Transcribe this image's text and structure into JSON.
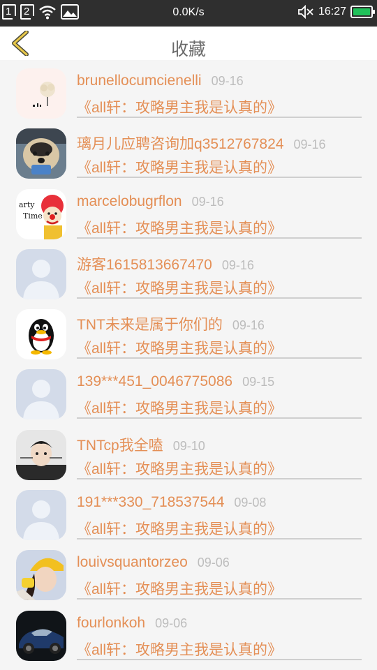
{
  "status_bar": {
    "sim1": "1",
    "sim2": "2",
    "speed": "0.0K/s",
    "time": "16:27",
    "icons": [
      "sim-1-icon",
      "sim-2-icon",
      "wifi-icon",
      "image-icon",
      "mute-icon",
      "battery-icon"
    ],
    "battery_color": "#20c25a"
  },
  "header": {
    "title": "收藏",
    "back_icon": "chevron-left-icon",
    "accent": "#e8c84a"
  },
  "items": [
    {
      "name": "brunellocumcienelli",
      "date": "09-16",
      "text": "《all轩：攻略男主我是认真的》",
      "avatar": "tree-avatar"
    },
    {
      "name": "璃月儿应聘咨询加q3512767824",
      "date": "09-16",
      "text": "《all轩：攻略男主我是认真的》",
      "avatar": "dog-avatar"
    },
    {
      "name": "marcelobugrflon",
      "date": "09-16",
      "text": "《all轩：攻略男主我是认真的》",
      "avatar": "clown-avatar"
    },
    {
      "name": "游客1615813667470",
      "date": "09-16",
      "text": "《all轩：攻略男主我是认真的》",
      "avatar": "default-avatar"
    },
    {
      "name": "TNT未来是属于你们的",
      "date": "09-16",
      "text": "《all轩：攻略男主我是认真的》",
      "avatar": "penguin-avatar"
    },
    {
      "name": "139***451_0046775086",
      "date": "09-15",
      "text": "《all轩：攻略男主我是认真的》",
      "avatar": "default-avatar"
    },
    {
      "name": "TNTcp我全嗑",
      "date": "09-10",
      "text": "《all轩：攻略男主我是认真的》",
      "avatar": "boy-avatar"
    },
    {
      "name": "191***330_718537544",
      "date": "09-08",
      "text": "《all轩：攻略男主我是认真的》",
      "avatar": "default-avatar"
    },
    {
      "name": "louivsquantorzeo",
      "date": "09-06",
      "text": "《all轩：攻略男主我是认真的》",
      "avatar": "girl-yellow-hat-avatar"
    },
    {
      "name": "fourlonkoh",
      "date": "09-06",
      "text": "《all轩：攻略男主我是认真的》",
      "avatar": "car-avatar"
    }
  ]
}
